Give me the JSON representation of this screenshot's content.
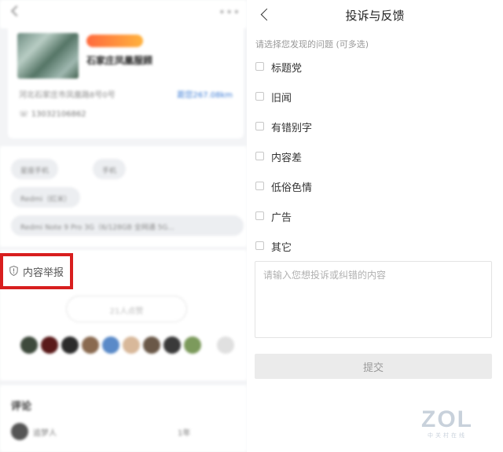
{
  "background_page": {
    "store": {
      "name": "石家庄凤凰服顾",
      "address": "河北石家庄市凤凰路8号0号",
      "distance": "距您267.08km",
      "phone": "13032106862"
    },
    "tags": [
      "星座手机",
      "手机",
      "Redmi（红米）",
      "Redmi Note 9 Pro  3G（6/128GB 全网通 5G..."
    ],
    "report_label": "内容举报",
    "like_label": "21人点赞",
    "comments": {
      "title": "评论",
      "first_user": "追梦人",
      "first_time": "1年"
    }
  },
  "feedback_form": {
    "title": "投诉与反馈",
    "hint": "请选择您发现的问题 (可多选)",
    "options": [
      "标题党",
      "旧闻",
      "有错别字",
      "内容差",
      "低俗色情",
      "广告",
      "其它"
    ],
    "textarea_placeholder": "请输入您想投诉或纠错的内容",
    "submit_label": "提交"
  },
  "watermark": {
    "logo": "ZOL",
    "subtitle": "中关村在线"
  },
  "colors": {
    "highlight_box": "#d81e1e",
    "submit_disabled_bg": "#ebebeb",
    "distance_accent": "#3a7bd5"
  }
}
